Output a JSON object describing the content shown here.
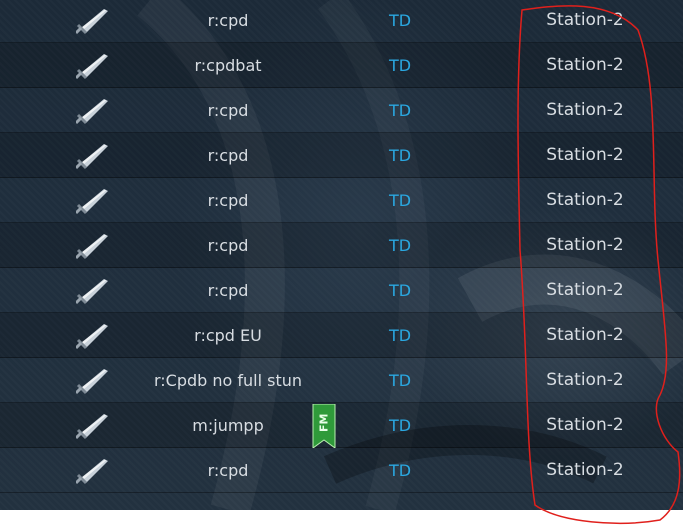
{
  "rows": [
    {
      "name": "r:cpd",
      "class": "TD",
      "server": "Station-2",
      "icon": "sword-icon"
    },
    {
      "name": "r:cpdbat",
      "class": "TD",
      "server": "Station-2",
      "icon": "sword-icon"
    },
    {
      "name": "r:cpd",
      "class": "TD",
      "server": "Station-2",
      "icon": "sword-icon"
    },
    {
      "name": "r:cpd",
      "class": "TD",
      "server": "Station-2",
      "icon": "sword-icon"
    },
    {
      "name": "r:cpd",
      "class": "TD",
      "server": "Station-2",
      "icon": "sword-icon"
    },
    {
      "name": "r:cpd",
      "class": "TD",
      "server": "Station-2",
      "icon": "sword-icon"
    },
    {
      "name": "r:cpd",
      "class": "TD",
      "server": "Station-2",
      "icon": "sword-icon"
    },
    {
      "name": "r:cpd EU",
      "class": "TD",
      "server": "Station-2",
      "icon": "sword-icon"
    },
    {
      "name": "r:Cpdb no full stun",
      "class": "TD",
      "server": "Station-2",
      "icon": "sword-icon"
    },
    {
      "name": "m:jumpp",
      "class": "TD",
      "server": "Station-2",
      "icon": "sword-icon",
      "badge": "FM"
    },
    {
      "name": "r:cpd",
      "class": "TD",
      "server": "Station-2",
      "icon": "sword-icon"
    }
  ],
  "colors": {
    "class_text": "#2aa7e0",
    "fm_badge": "#2f9a3a",
    "annotation": "#e0201c"
  }
}
